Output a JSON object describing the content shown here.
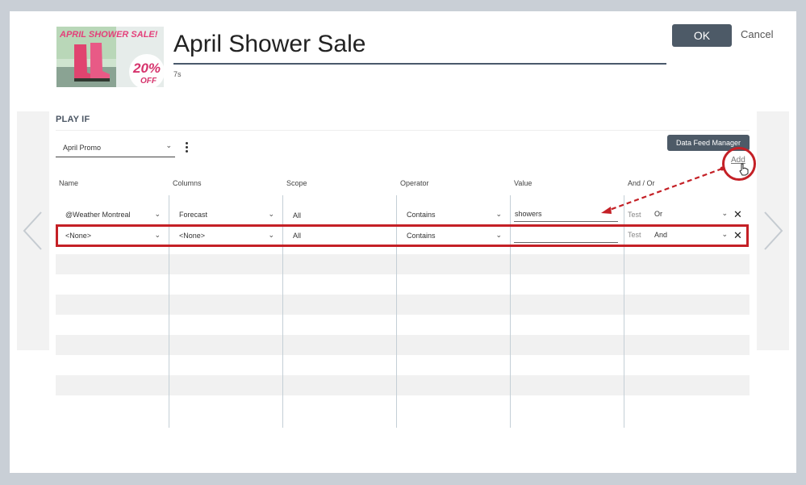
{
  "header": {
    "title": "April Shower Sale",
    "duration": "7s",
    "ok_label": "OK",
    "cancel_label": "Cancel"
  },
  "thumbnail": {
    "headline": "APRIL SHOWER SALE!",
    "discount": "20%",
    "discount_sub": "OFF"
  },
  "play_if": {
    "section_label": "PLAY IF",
    "campaign_select": "April Promo",
    "data_feed_button": "Data Feed Manager",
    "add_label": "Add"
  },
  "table": {
    "columns": [
      "Name",
      "Columns",
      "Scope",
      "Operator",
      "Value",
      "And / Or"
    ],
    "rows": [
      {
        "name": "@Weather Montreal",
        "column": "Forecast",
        "scope": "All",
        "operator": "Contains",
        "value": "showers",
        "test": "Test",
        "andor": "Or"
      },
      {
        "name": "<None>",
        "column": "<None>",
        "scope": "All",
        "operator": "Contains",
        "value": "",
        "test": "Test",
        "andor": "And"
      }
    ]
  },
  "colors": {
    "highlight": "#c42026",
    "button": "#4d5a67"
  }
}
